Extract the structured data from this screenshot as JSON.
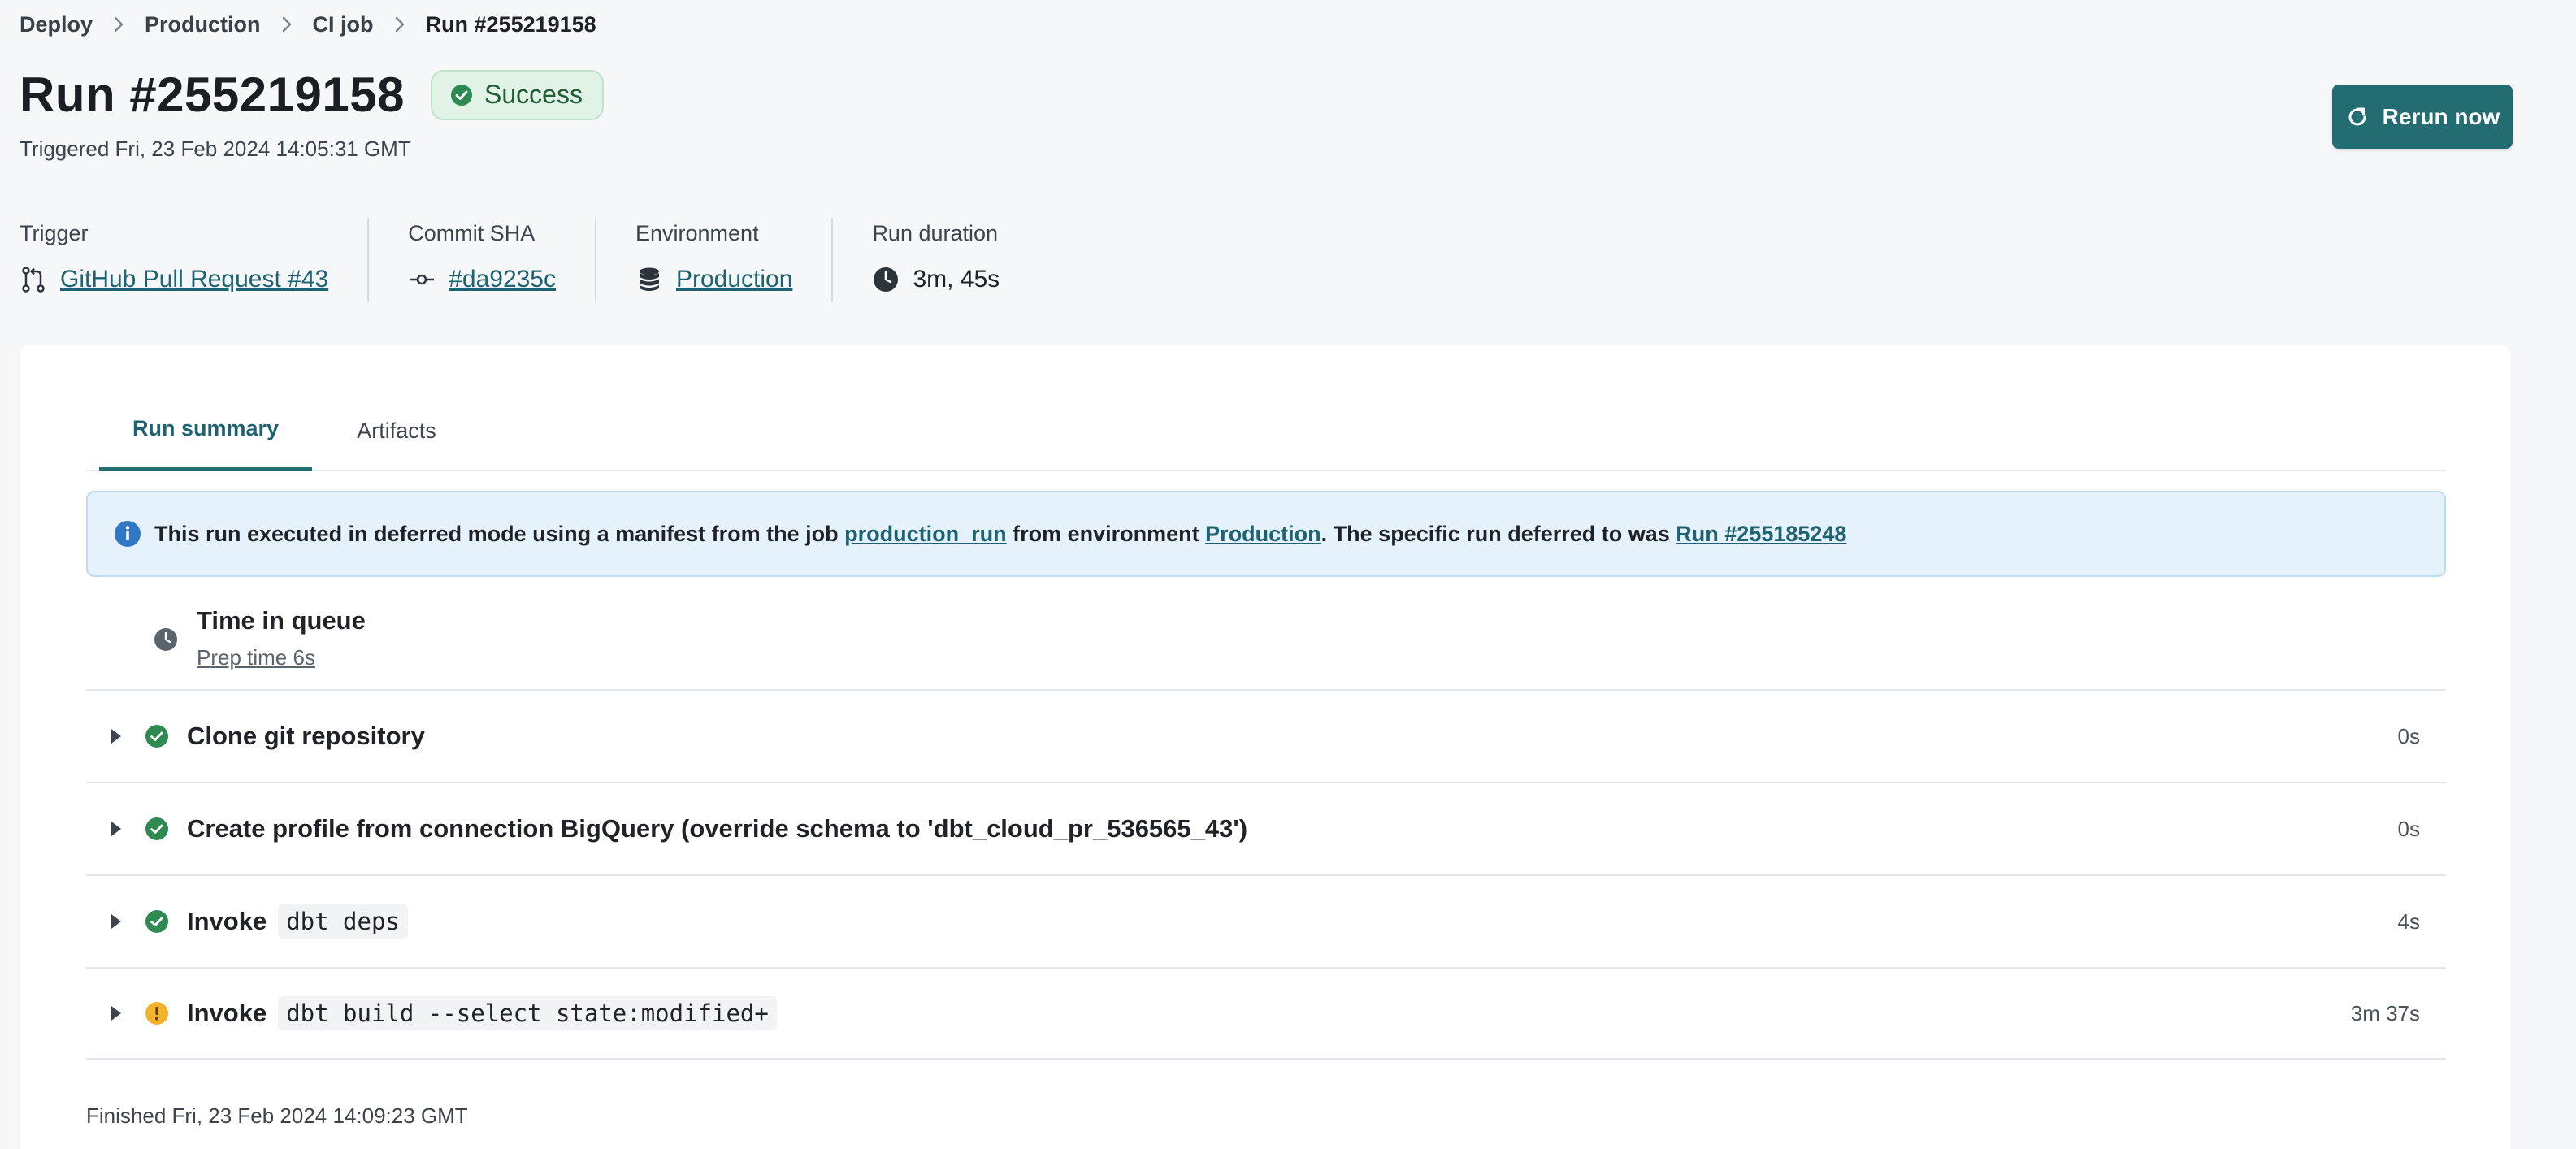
{
  "breadcrumb": {
    "items": [
      "Deploy",
      "Production",
      "CI job"
    ],
    "current": "Run #255219158"
  },
  "header": {
    "title": "Run #255219158",
    "status": "Success",
    "triggered": "Triggered Fri, 23 Feb 2024 14:05:31 GMT",
    "rerun_label": "Rerun now"
  },
  "meta": {
    "trigger_label": "Trigger",
    "trigger_value": "GitHub Pull Request #43",
    "commit_label": "Commit SHA",
    "commit_value": "#da9235c",
    "environment_label": "Environment",
    "environment_value": "Production",
    "duration_label": "Run duration",
    "duration_value": "3m, 45s"
  },
  "tabs": {
    "run_summary": "Run summary",
    "artifacts": "Artifacts"
  },
  "info": {
    "text_1": "This run executed in deferred mode using a manifest from the job ",
    "job_link": "production_run",
    "text_2": " from environment ",
    "env_link": "Production",
    "text_3": ". The specific run deferred to was ",
    "run_link": "Run #255185248"
  },
  "queue": {
    "title": "Time in queue",
    "prep": "Prep time 6s"
  },
  "steps": [
    {
      "label": "Clone git repository",
      "code": "",
      "duration": "0s",
      "status": "success"
    },
    {
      "label": "Create profile from connection BigQuery (override schema to 'dbt_cloud_pr_536565_43')",
      "code": "",
      "duration": "0s",
      "status": "success"
    },
    {
      "label": "Invoke",
      "code": "dbt deps",
      "duration": "4s",
      "status": "success"
    },
    {
      "label": "Invoke",
      "code": "dbt build --select state:modified+",
      "duration": "3m 37s",
      "status": "warning"
    }
  ],
  "footer": {
    "finished": "Finished Fri, 23 Feb 2024 14:09:23 GMT"
  },
  "colors": {
    "accent": "#236c72",
    "success": "#2f8a52",
    "warning": "#f2b32a",
    "info": "#2f78c4"
  }
}
